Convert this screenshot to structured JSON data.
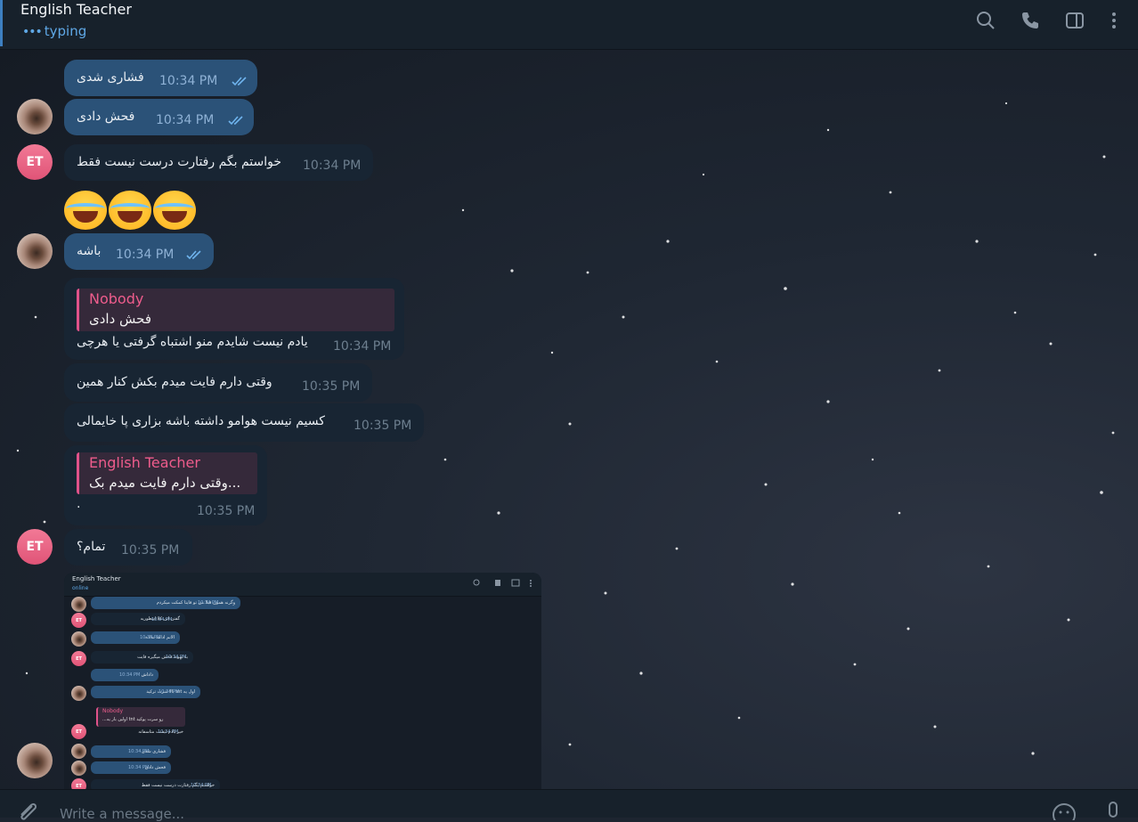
{
  "header": {
    "title": "English Teacher",
    "status": "typing",
    "status_dots": "•••",
    "icons": [
      "search-icon",
      "phone-icon",
      "sidebar-toggle-icon",
      "more-vert-icon"
    ]
  },
  "messages": {
    "m1": {
      "text": "فشاری شدی",
      "time": "10:34 PM"
    },
    "m2": {
      "text": "فحش دادی",
      "time": "10:34 PM"
    },
    "m3": {
      "text": "خواستم بگم رفتارت درست نیست فقط",
      "time": "10:34 PM"
    },
    "m4": {
      "emoji": "😂😂😂"
    },
    "m5": {
      "text": "باشه",
      "time": "10:34 PM"
    },
    "m6": {
      "reply_name": "Nobody",
      "reply_text": "فحش دادی",
      "text": "یادم نیست شایدم منو اشتباه گرفتی یا هرچی",
      "time": "10:34 PM"
    },
    "m7": {
      "text": "وقتی دارم فایت میدم بکش کنار همین",
      "time": "10:35 PM"
    },
    "m8": {
      "text": "کسیم نیست هوامو داشته باشه بزاری پا خایمالی",
      "time": "10:35 PM"
    },
    "m9": {
      "reply_name": "English Teacher",
      "reply_text": "...وقتی دارم فایت میدم بک",
      "text": ".",
      "time": "10:35 PM"
    },
    "m10": {
      "text": "تمام؟",
      "time": "10:35 PM"
    }
  },
  "avatar": {
    "initials": "ET"
  },
  "screenshot": {
    "title": "English Teacher",
    "status": "online",
    "rows": [
      {
        "text": "وگرنه همون قبلا من تو فایتا کمکت میکردم",
        "time": "10:34 PM"
      },
      {
        "text": "گفتن این کلا اینطوریه",
        "time": "10:34 PM"
      },
      {
        "text": "الانم ادامه نداده",
        "time": "10:34 PM"
      },
      {
        "text": "به بهونه فحش میگیره فایت",
        "time": "10:34 PM"
      },
      {
        "text": "داداش",
        "time": "10:34 PM"
      },
      {
        "text": "اول یه tnt بالا سرت ترکید",
        "time": "10:34 PM"
      },
      {
        "text": "خیر یادم نیست متاسفانه",
        "time": "10:34 PM"
      },
      {
        "text": "فشاری شدی",
        "time": "10:34 PM"
      },
      {
        "text": "فحش دادی",
        "time": "10:34 PM"
      },
      {
        "text": "خواستم بگم رفتارت درست نیست فقط",
        "time": "10:34 PM"
      }
    ],
    "reply_name": "Nobody",
    "reply_text": "رو سرت پوکید tnt اولین بار یه..."
  },
  "composer": {
    "placeholder": "Write a message..."
  },
  "colors": {
    "accent": "#5fa8e6",
    "outgoing": "#2b5278",
    "incoming": "#182533",
    "reply_name": "#ee5c8c"
  }
}
